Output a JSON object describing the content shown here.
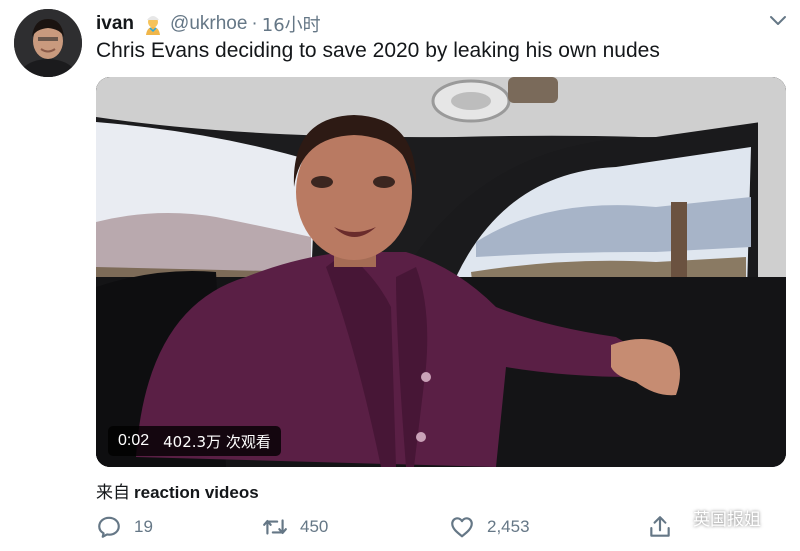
{
  "tweet": {
    "display_name": "ivan",
    "badge_icon": "genie-emoji-icon",
    "handle": "@ukrhoe",
    "separator": "·",
    "time": "16小时",
    "text": "Chris Evans deciding to save 2020 by leaking his own nudes",
    "menu_icon": "chevron-down-icon"
  },
  "media": {
    "elapsed": "0:02",
    "views": "402.3万 次观看"
  },
  "source": {
    "prefix": "来自",
    "name": "reaction videos"
  },
  "actions": {
    "reply_count": "19",
    "retweet_count": "450",
    "like_count": "2,453"
  },
  "watermark": {
    "text": "英国报姐"
  },
  "colors": {
    "secondary_text": "#657786",
    "primary_text": "#14171a",
    "jacket": "#5a1f45"
  }
}
